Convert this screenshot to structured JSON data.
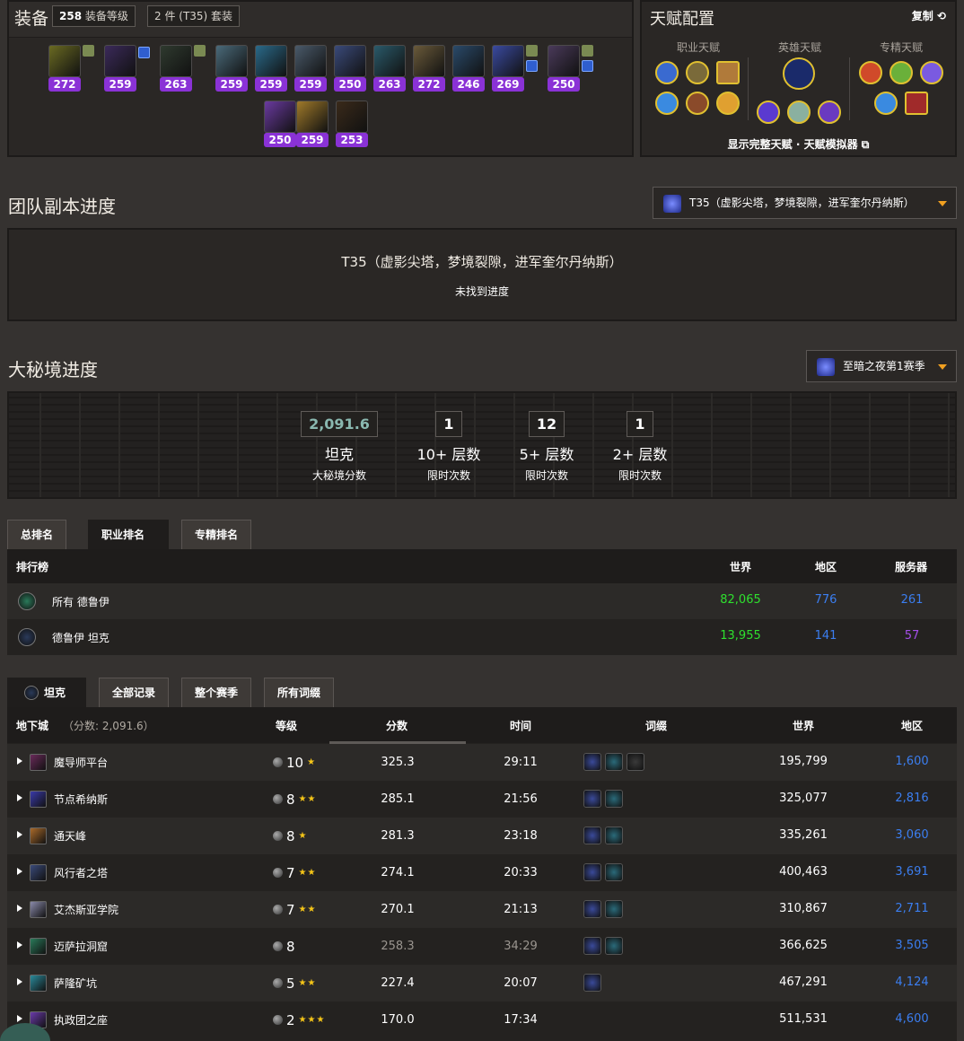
{
  "equipment": {
    "title": "装备",
    "ilvl_badge_num": "258",
    "ilvl_badge_text": " 装备等级",
    "set_badge": "2 件 (T35) 套装",
    "items": [
      {
        "ilvl": "272",
        "color": "#6a6a22"
      },
      {
        "ilvl": "259",
        "color": "#3b2a5a"
      },
      {
        "ilvl": "263",
        "color": "#2f3a2f"
      },
      {
        "ilvl": "259",
        "color": "#4a6a7a"
      },
      {
        "ilvl": "259",
        "color": "#2a6a8a"
      },
      {
        "ilvl": "259",
        "color": "#4a5a6a"
      },
      {
        "ilvl": "250",
        "color": "#3a4a7a"
      },
      {
        "ilvl": "263",
        "color": "#2a5a6a"
      },
      {
        "ilvl": "272",
        "color": "#6a5a3a"
      },
      {
        "ilvl": "246",
        "color": "#2a4a6a"
      },
      {
        "ilvl": "269",
        "color": "#3a4aa0"
      },
      {
        "ilvl": "250",
        "color": "#4a3a5a"
      },
      {
        "ilvl": "250",
        "color": "#6a3aa0"
      },
      {
        "ilvl": "259",
        "color": "#a07a2a"
      },
      {
        "ilvl": "253",
        "color": "#3a2a1a"
      }
    ]
  },
  "talents": {
    "title": "天赋配置",
    "copy": "复制",
    "col_class": "职业天赋",
    "col_hero": "英雄天赋",
    "col_spec": "专精天赋",
    "footer": "显示完整天赋 · 天赋模拟器"
  },
  "raid": {
    "title": "团队副本进度",
    "dropdown": "T35（虚影尖塔，梦境裂隙，进军奎尔丹纳斯）",
    "box_title": "T35（虚影尖塔，梦境裂隙，进军奎尔丹纳斯）",
    "box_sub": "未找到进度"
  },
  "mplus": {
    "title": "大秘境进度",
    "dropdown": "至暗之夜第1赛季",
    "stats": [
      {
        "value": "2,091.6",
        "big": "坦克",
        "small": "大秘境分数"
      },
      {
        "value": "1",
        "big": "10+ 层数",
        "small": "限时次数"
      },
      {
        "value": "12",
        "big": "5+ 层数",
        "small": "限时次数"
      },
      {
        "value": "1",
        "big": "2+ 层数",
        "small": "限时次数"
      }
    ]
  },
  "rank_tabs": [
    "总排名",
    "职业排名",
    "专精排名"
  ],
  "rank_table": {
    "headers": {
      "board": "排行榜",
      "world": "世界",
      "region": "地区",
      "server": "服务器"
    },
    "rows": [
      {
        "label": "所有 德鲁伊",
        "world": "82,065",
        "region": "776",
        "server": "261",
        "server_color": "#3b7ef0"
      },
      {
        "label": "德鲁伊 坦克",
        "world": "13,955",
        "region": "141",
        "server": "57",
        "server_color": "#a34ee8"
      }
    ]
  },
  "dungeon_tabs": [
    "坦克",
    "全部记录",
    "整个赛季",
    "所有词缀"
  ],
  "dungeon_table": {
    "headers": {
      "dungeon": "地下城",
      "score_note": "（分数: 2,091.6）",
      "level": "等级",
      "score": "分数",
      "time": "时间",
      "affix": "词缀",
      "world": "世界",
      "region": "地区"
    },
    "rows": [
      {
        "name": "魔导师平台",
        "level": "10",
        "stars": "★",
        "score": "325.3",
        "time": "29:11",
        "affixes": 3,
        "world": "195,799",
        "region": "1,600",
        "color": "#6a2a5a",
        "dim": false
      },
      {
        "name": "节点希纳斯",
        "level": "8",
        "stars": "★★",
        "score": "285.1",
        "time": "21:56",
        "affixes": 2,
        "world": "325,077",
        "region": "2,816",
        "color": "#3a3aaa",
        "dim": false
      },
      {
        "name": "通天峰",
        "level": "8",
        "stars": "★",
        "score": "281.3",
        "time": "23:18",
        "affixes": 2,
        "world": "335,261",
        "region": "3,060",
        "color": "#aa6a2a",
        "dim": false
      },
      {
        "name": "风行者之塔",
        "level": "7",
        "stars": "★★",
        "score": "274.1",
        "time": "20:33",
        "affixes": 2,
        "world": "400,463",
        "region": "3,691",
        "color": "#3a4a7a",
        "dim": false
      },
      {
        "name": "艾杰斯亚学院",
        "level": "7",
        "stars": "★★",
        "score": "270.1",
        "time": "21:13",
        "affixes": 2,
        "world": "310,867",
        "region": "2,711",
        "color": "#8a8aaa",
        "dim": false
      },
      {
        "name": "迈萨拉洞窟",
        "level": "8",
        "stars": "",
        "score": "258.3",
        "time": "34:29",
        "affixes": 2,
        "world": "366,625",
        "region": "3,505",
        "color": "#2a7a5a",
        "dim": true
      },
      {
        "name": "萨隆矿坑",
        "level": "5",
        "stars": "★★",
        "score": "227.4",
        "time": "20:07",
        "affixes": 1,
        "world": "467,291",
        "region": "4,124",
        "color": "#2a8a9a",
        "dim": false
      },
      {
        "name": "执政团之座",
        "level": "2",
        "stars": "★★★",
        "score": "170.0",
        "time": "17:34",
        "affixes": 0,
        "world": "511,531",
        "region": "4,600",
        "color": "#6a3aaa",
        "dim": false
      }
    ]
  }
}
